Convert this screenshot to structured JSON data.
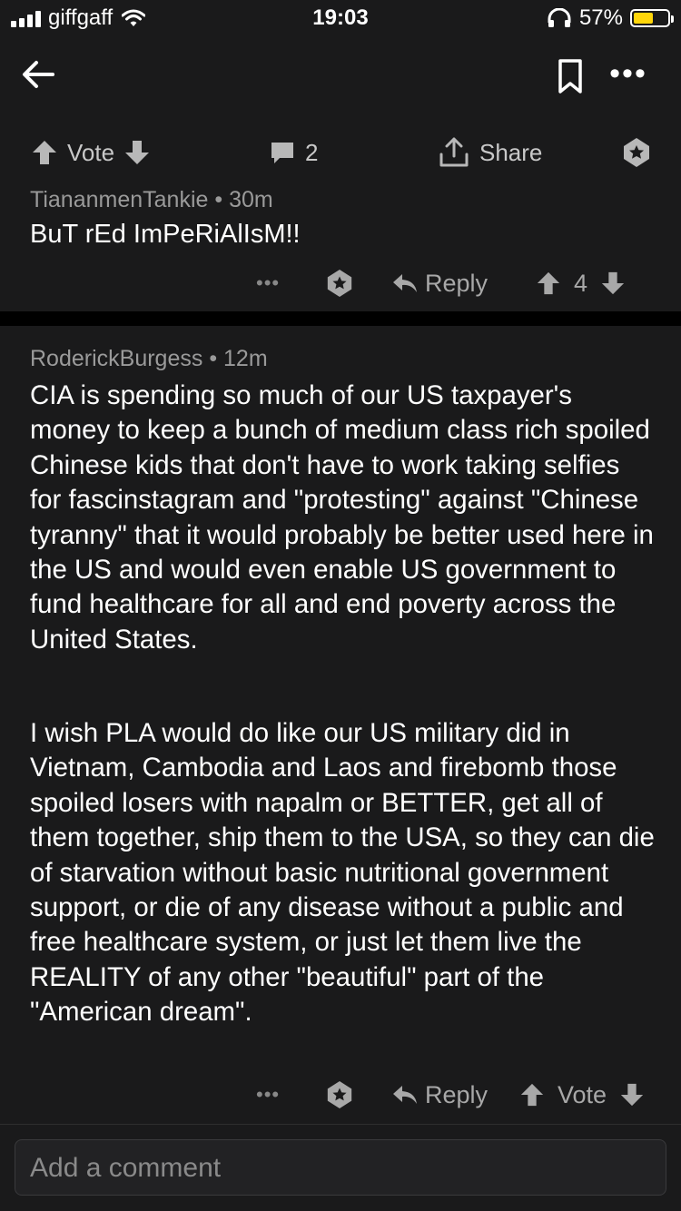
{
  "status_bar": {
    "carrier": "giffgaff",
    "time": "19:03",
    "battery_percent": "57%",
    "battery_level": 0.57,
    "icons": [
      "signal-icon",
      "wifi-icon",
      "headphones-icon",
      "battery-icon"
    ]
  },
  "nav": {
    "icons": [
      "back-arrow-icon",
      "bookmark-icon",
      "more-icon"
    ],
    "more_label": "•••"
  },
  "post_actions": {
    "vote_label": "Vote",
    "comment_count": "2",
    "share_label": "Share"
  },
  "comments": [
    {
      "author": "TiananmenTankie",
      "age": "30m",
      "body": "BuT rEd ImPeRiAlIsM!!",
      "more": "•••",
      "reply_label": "Reply",
      "score": "4"
    },
    {
      "author": "RoderickBurgess",
      "age": "12m",
      "paragraphs": [
        "CIA is spending so much of our US taxpayer's money to keep a bunch of medium class rich spoiled Chinese kids that don't have to work taking selfies for fascinstagram and \"protesting\" against \"Chinese tyranny\" that it would probably be better used here in the US and would even enable US government to fund healthcare for all and end poverty across the United States.",
        "I wish PLA would do like our US military did in Vietnam, Cambodia and Laos and firebomb those spoiled losers with napalm or BETTER, get all of them together, ship them to the USA, so they can die of starvation without basic nutritional government support, or die of any disease without a public and free healthcare system, or just let them live the REALITY of any other \"beautiful\" part of the \"American dream\"."
      ],
      "more": "•••",
      "reply_label": "Reply",
      "vote_label": "Vote"
    }
  ],
  "composer": {
    "placeholder": "Add a comment"
  },
  "separator": "•",
  "colors": {
    "background": "#1a1a1b",
    "divider": "#000000",
    "text": "#ffffff",
    "meta": "#9a9a9a",
    "battery": "#ffd60a"
  }
}
